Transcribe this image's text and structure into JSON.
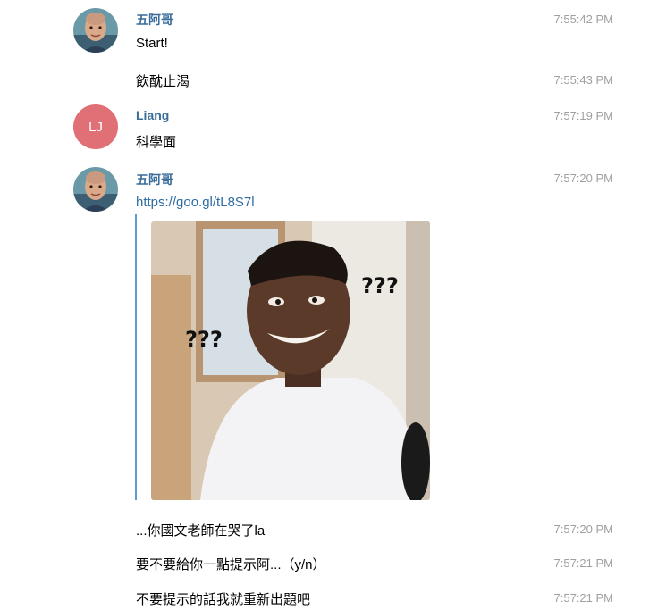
{
  "messages": [
    {
      "sender": "五阿哥",
      "text": "Start!",
      "time": "7:55:42 PM"
    },
    {
      "text": "飲酖止渴",
      "time": "7:55:43 PM"
    },
    {
      "sender": "Liang",
      "avatar_initials": "LJ",
      "avatar_color": "#e17076",
      "text": "科學面",
      "time": "7:57:19 PM"
    },
    {
      "sender": "五阿哥",
      "link": "https://goo.gl/tL8S7l",
      "time": "7:57:20 PM",
      "preview": {
        "overlay_left": "???",
        "overlay_right": "???"
      }
    },
    {
      "text": "...你國文老師在哭了la",
      "time": "7:57:20 PM"
    },
    {
      "text": "要不要給你一點提示阿...（y/n）",
      "time": "7:57:21 PM"
    },
    {
      "text": "不要提示的話我就重新出題吧",
      "time": "7:57:21 PM"
    }
  ],
  "colors": {
    "sender_name": "#3a6d99",
    "link": "#2e6da4",
    "preview_bar": "#5a9bd4",
    "timestamp": "#a0a0a0"
  },
  "icons": {
    "avatar_1": "bald-man-avatar-icon",
    "avatar_2": "bald-man-avatar-icon"
  }
}
